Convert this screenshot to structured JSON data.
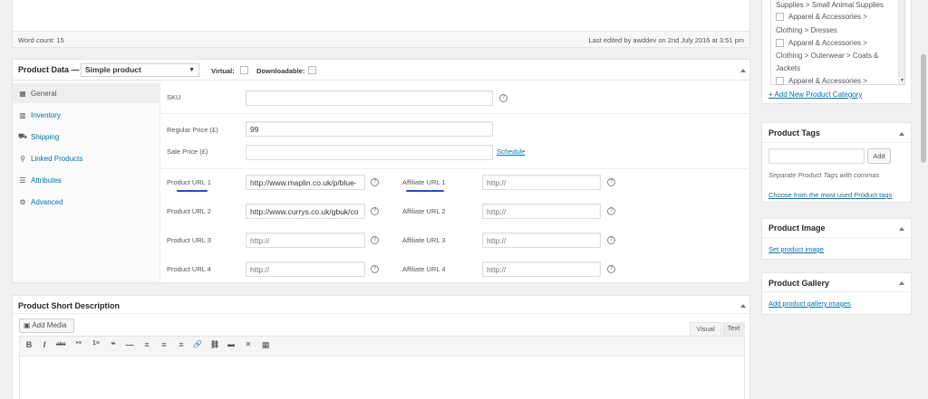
{
  "editor": {
    "word_count": "Word count: 15",
    "last_edited": "Last edited by awddev on 2nd July 2016 at 3:51 pm"
  },
  "product_data": {
    "title": "Product Data —",
    "type_select": "Simple product",
    "virtual_label": "Virtual:",
    "downloadable_label": "Downloadable:",
    "tabs": [
      {
        "label": "General",
        "icon": "grid-icon"
      },
      {
        "label": "Inventory",
        "icon": "chart-icon"
      },
      {
        "label": "Shipping",
        "icon": "truck-icon"
      },
      {
        "label": "Linked Products",
        "icon": "link-icon"
      },
      {
        "label": "Attributes",
        "icon": "list-icon"
      },
      {
        "label": "Advanced",
        "icon": "gear-icon"
      }
    ],
    "sku_label": "SKU",
    "sku_value": "",
    "regular_price_label": "Regular Price (£)",
    "regular_price_value": "99",
    "sale_price_label": "Sale Price (£)",
    "sale_price_value": "",
    "schedule_link": "Schedule",
    "help_glyph": "?",
    "product_urls": [
      {
        "label": "Product URL 1",
        "value": "http://www.maplin.co.uk/p/blue-",
        "placeholder": "http://"
      },
      {
        "label": "Product URL 2",
        "value": "http://www.currys.co.uk/gbuk/co",
        "placeholder": "http://"
      },
      {
        "label": "Product URL 3",
        "value": "",
        "placeholder": "http://"
      },
      {
        "label": "Product URL 4",
        "value": "",
        "placeholder": "http://"
      }
    ],
    "affiliate_urls": [
      {
        "label": "Affiliate URL 1",
        "value": "",
        "placeholder": "http://"
      },
      {
        "label": "Affiliate URL 2",
        "value": "",
        "placeholder": "http://"
      },
      {
        "label": "Affiliate URL 3",
        "value": "",
        "placeholder": "http://"
      },
      {
        "label": "Affiliate URL 4",
        "value": "",
        "placeholder": "http://"
      }
    ]
  },
  "short_description": {
    "title": "Product Short Description",
    "add_media": "Add Media",
    "tab_visual": "Visual",
    "tab_text": "Text",
    "toolbar": [
      "B",
      "I",
      "abc",
      "•≡",
      "1≡",
      "❝",
      "—",
      "≡",
      "≡",
      "≡",
      "🔗",
      "⛓",
      "▬",
      "✕",
      "▦"
    ]
  },
  "categories": {
    "lines": [
      "Supplies > Small Animal Supplies",
      "Apparel & Accessories >",
      "Clothing > Dresses",
      "Apparel & Accessories >",
      "Clothing > Outerwear > Coats &",
      "Jackets",
      "Apparel & Accessories >"
    ],
    "add_new": "+ Add New Product Category"
  },
  "product_tags": {
    "title": "Product Tags",
    "add_button": "Add",
    "hint": "Separate Product Tags with commas",
    "choose_link": "Choose from the most used Product tags"
  },
  "product_image": {
    "title": "Product Image",
    "set_link": "Set product image"
  },
  "product_gallery": {
    "title": "Product Gallery",
    "add_link": "Add product gallery images"
  }
}
